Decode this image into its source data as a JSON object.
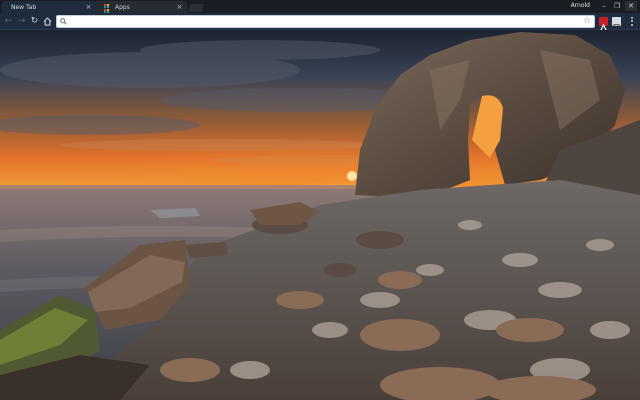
{
  "tabs": [
    {
      "label": "New Tab",
      "active": true
    },
    {
      "label": "Apps",
      "active": false,
      "icon": "apps-grid-icon"
    }
  ],
  "profile": {
    "name": "Arnold"
  },
  "omnibox": {
    "value": "",
    "placeholder": ""
  },
  "colors": {
    "tab_active": "#1f2c3e",
    "toolbar": "#1f2c3e",
    "tabstrip": "#1a1d23",
    "extension_red": "#c81e25"
  },
  "icons": {
    "back": "arrow-left-icon",
    "forward": "arrow-right-icon",
    "reload": "reload-icon",
    "home": "home-icon",
    "search": "search-icon",
    "bookmark": "star-icon",
    "menu": "more-vertical-icon"
  }
}
